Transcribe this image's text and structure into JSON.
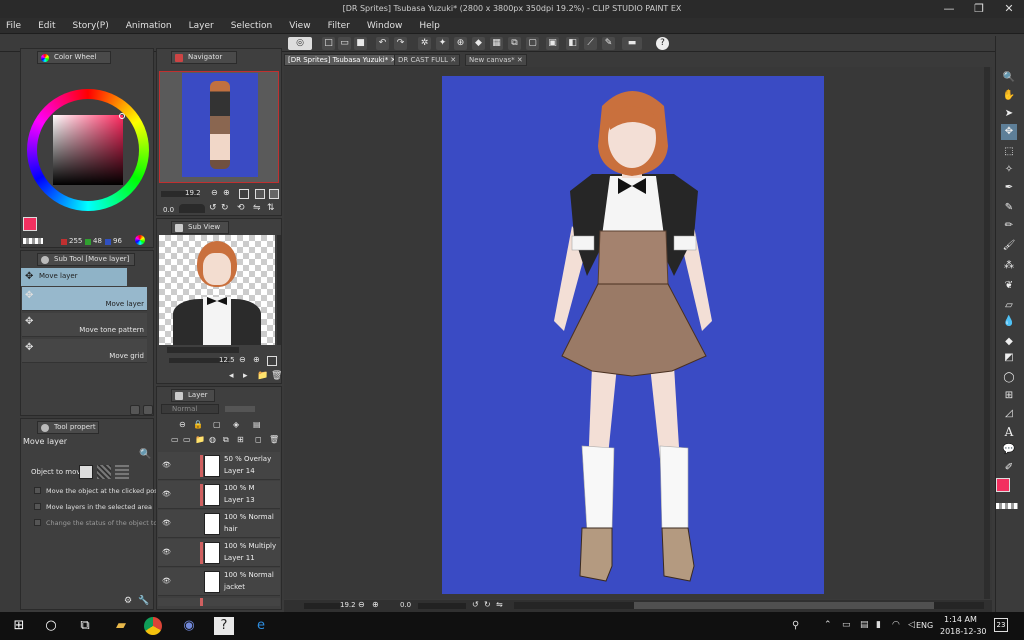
{
  "window": {
    "title": "[DR Sprites] Tsubasa Yuzuki* (2800 x 3800px 350dpi 19.2%)  - CLIP STUDIO PAINT EX",
    "minimize": "—",
    "maximize": "❐",
    "close": "✕"
  },
  "menu": [
    "File",
    "Edit",
    "Story(P)",
    "Animation",
    "Layer",
    "Selection",
    "View",
    "Filter",
    "Window",
    "Help"
  ],
  "colorwheel": {
    "tab": "Color Wheel",
    "r": "255",
    "g": "48",
    "b": "96",
    "main_color": "#f23060",
    "sub_color": "#ffffff"
  },
  "navigator": {
    "tab": "Navigator",
    "zoom": "19.2",
    "angle": "0.0"
  },
  "subview": {
    "tab": "Sub View",
    "zoom": "12.5"
  },
  "subtool": {
    "tab": "Sub Tool [Move layer]",
    "group": "Move layer",
    "items": [
      "Move layer",
      "Move tone pattern",
      "Move grid"
    ]
  },
  "toolprop": {
    "tab": "Tool propert",
    "title": "Move layer",
    "object_label": "Object to move",
    "options": [
      "Move the object at the clicked posit",
      "Move layers in the selected area",
      "Change the status of the object to"
    ]
  },
  "layer": {
    "tab": "Layer",
    "blend": "Normal",
    "rows": [
      {
        "line1": "50 % Overlay",
        "line2": "Layer 14"
      },
      {
        "line1": "100 % M",
        "line2": "Layer 13"
      },
      {
        "line1": "100 % Normal",
        "line2": "hair"
      },
      {
        "line1": "100 % Multiply",
        "line2": "Layer 11"
      },
      {
        "line1": "100 % Normal",
        "line2": "jacket"
      }
    ]
  },
  "docs": {
    "tabs": [
      "[DR Sprites] Tsubasa Yuzuki*",
      "DR CAST FULL",
      "New canvas*"
    ],
    "zoom": "19.2",
    "angle": "0.0",
    "canvas_color": "#3a4bc4"
  },
  "taskbar": {
    "lang": "ENG",
    "time": "1:14 AM",
    "date": "2018-12-30",
    "notifications": "23"
  }
}
